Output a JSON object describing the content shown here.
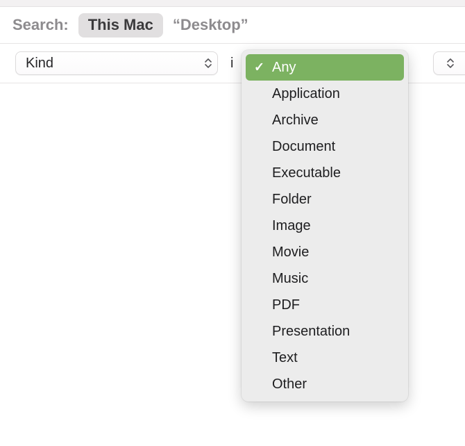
{
  "scope": {
    "label": "Search:",
    "selected_scope": "This Mac",
    "alt_scope": "“Desktop”"
  },
  "criteria": {
    "attribute": "Kind",
    "operator_partial": "i"
  },
  "kind_menu": {
    "selected_index": 0,
    "items": [
      "Any",
      "Application",
      "Archive",
      "Document",
      "Executable",
      "Folder",
      "Image",
      "Movie",
      "Music",
      "PDF",
      "Presentation",
      "Text",
      "Other"
    ]
  }
}
